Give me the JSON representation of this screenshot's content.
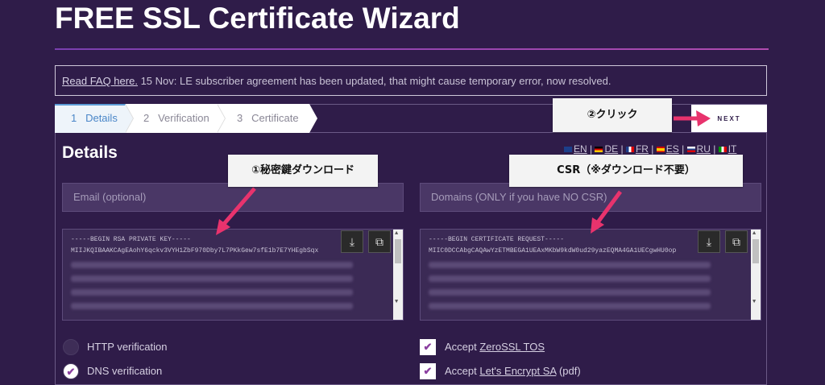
{
  "header": {
    "title": "FREE SSL Certificate Wizard"
  },
  "notice": {
    "link_text": "Read FAQ here.",
    "text": " 15 Nov: LE subscriber agreement has been updated, that might cause temporary error, now resolved."
  },
  "steps": [
    {
      "num": "1",
      "label": "Details"
    },
    {
      "num": "2",
      "label": "Verification"
    },
    {
      "num": "3",
      "label": "Certificate"
    }
  ],
  "next_button": {
    "label": "NEXT"
  },
  "details": {
    "heading": "Details"
  },
  "languages": [
    "EN",
    "DE",
    "FR",
    "ES",
    "RU",
    "IT"
  ],
  "colors": {
    "background": "#2f1c49",
    "accent": "#8b3fa0",
    "annotation_arrow": "#e8336d",
    "active_step": "#4a86c8"
  },
  "email_input": {
    "placeholder": "Email (optional)",
    "value": ""
  },
  "domains_input": {
    "placeholder": "Domains (ONLY if you have NO CSR)",
    "value": ""
  },
  "private_key": {
    "line1": "-----BEGIN RSA PRIVATE KEY-----",
    "line2": "MIIJKQIBAAKCAgEAohY6qckv3VYH1ZbF970Dby7L7PKkGew7sfE1b7E7YHEgbSqx"
  },
  "csr": {
    "line1": "-----BEGIN CERTIFICATE REQUEST-----",
    "line2": "MIIC0DCCAbgCAQAwYzETMBEGA1UEAxMKbW9kdW0ud29yazEQMA4GA1UECgwHU0op"
  },
  "icons": {
    "download": "download-icon",
    "copy": "copy-icon"
  },
  "options": {
    "http_label": "HTTP verification",
    "dns_label": "DNS verification",
    "tos_prefix": "Accept ",
    "tos_link": "ZeroSSL TOS",
    "le_prefix": "Accept ",
    "le_link": "Let's Encrypt SA",
    "le_suffix": " (pdf)"
  },
  "annotations": {
    "click": "②クリック",
    "key_download": "①秘密鍵ダウンロード",
    "csr_note": "CSR（※ダウンロード不要）"
  }
}
